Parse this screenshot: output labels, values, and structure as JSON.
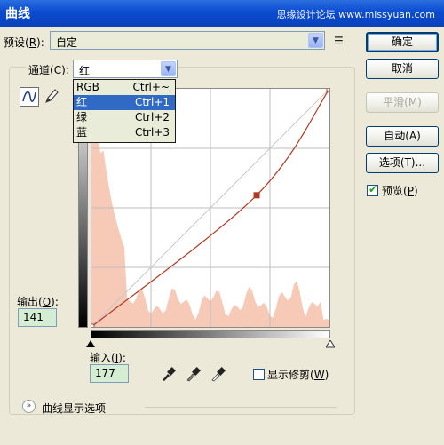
{
  "window": {
    "title": "曲线",
    "watermark": "思缘设计论坛 www.missyuan.com"
  },
  "preset": {
    "label": "预设",
    "mnemonic": "R",
    "value": "自定"
  },
  "channel": {
    "label": "通道",
    "mnemonic": "C",
    "value": "红",
    "options": [
      {
        "label": "RGB",
        "shortcut": "Ctrl+~"
      },
      {
        "label": "红",
        "shortcut": "Ctrl+1",
        "selected": true
      },
      {
        "label": "绿",
        "shortcut": "Ctrl+2"
      },
      {
        "label": "蓝",
        "shortcut": "Ctrl+3"
      }
    ]
  },
  "buttons": {
    "ok": "确定",
    "cancel": "取消",
    "smooth": "平滑(M)",
    "auto": "自动(A)",
    "options": "选项(T)..."
  },
  "preview": {
    "label": "预览",
    "mnemonic": "P",
    "checked": true
  },
  "output": {
    "label": "输出",
    "mnemonic": "O",
    "value": "141"
  },
  "input": {
    "label": "输入",
    "mnemonic": "I",
    "value": "177"
  },
  "show_clipping": {
    "label": "显示修剪",
    "mnemonic": "W",
    "checked": false
  },
  "curve_display_options": {
    "label": "曲线显示选项"
  },
  "chart_data": {
    "type": "line",
    "curve_points": [
      [
        0,
        0
      ],
      [
        177,
        141
      ],
      [
        255,
        255
      ]
    ],
    "xlim": [
      0,
      255
    ],
    "ylim": [
      0,
      255
    ],
    "grid": true,
    "colors": {
      "curve": "#b23a22",
      "histogram": "#f7c9b7",
      "grid": "#bdbdbd",
      "baseline": "#c8c8c8"
    }
  }
}
